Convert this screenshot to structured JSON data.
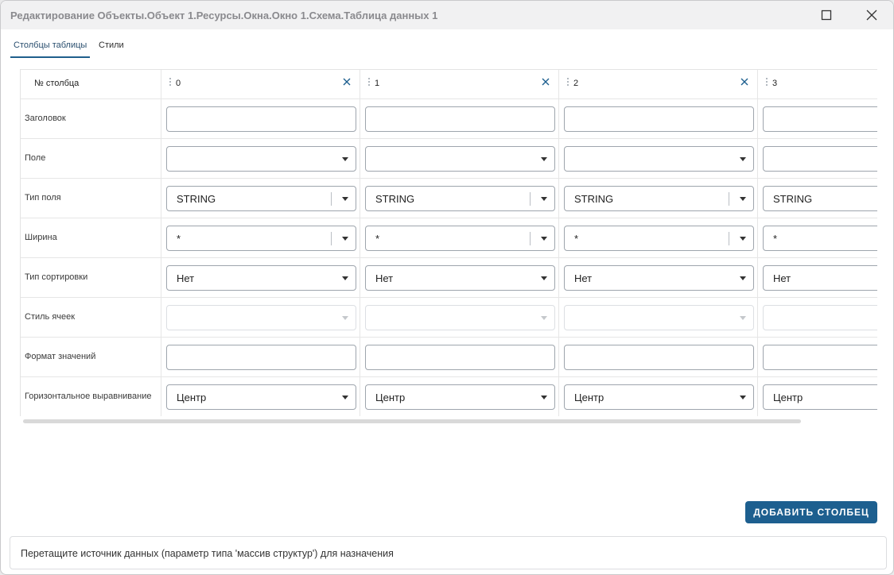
{
  "window": {
    "title": "Редактирование Объекты.Объект 1.Ресурсы.Окна.Окно 1.Схема.Таблица данных 1"
  },
  "tabs": [
    {
      "label": "Столбцы таблицы",
      "active": true
    },
    {
      "label": "Стили",
      "active": false
    }
  ],
  "grid": {
    "header_label": "№ столбца",
    "row_labels": {
      "title": "Заголовок",
      "field": "Поле",
      "field_type": "Тип поля",
      "width": "Ширина",
      "sort_type": "Тип сортировки",
      "cell_style": "Стиль ячеек",
      "value_format": "Формат значений",
      "h_align": "Горизонтальное выравнивание"
    },
    "columns": [
      {
        "number": "0",
        "title": "",
        "field": "",
        "field_type": "STRING",
        "width": "*",
        "sort_type": "Нет",
        "cell_style": "",
        "value_format": "",
        "h_align": "Центр"
      },
      {
        "number": "1",
        "title": "",
        "field": "",
        "field_type": "STRING",
        "width": "*",
        "sort_type": "Нет",
        "cell_style": "",
        "value_format": "",
        "h_align": "Центр"
      },
      {
        "number": "2",
        "title": "",
        "field": "",
        "field_type": "STRING",
        "width": "*",
        "sort_type": "Нет",
        "cell_style": "",
        "value_format": "",
        "h_align": "Центр"
      },
      {
        "number": "3",
        "title": "",
        "field": "",
        "field_type": "STRING",
        "width": "*",
        "sort_type": "Нет",
        "cell_style": "",
        "value_format": "",
        "h_align": "Центр"
      }
    ]
  },
  "actions": {
    "add_column": "ДОБАВИТЬ СТОЛБЕЦ"
  },
  "dropzone": {
    "text": "Перетащите источник данных (параметр типа 'массив структур') для назначения"
  },
  "colors": {
    "accent": "#1d5f8f",
    "tab_underline": "#1f5f8c"
  }
}
